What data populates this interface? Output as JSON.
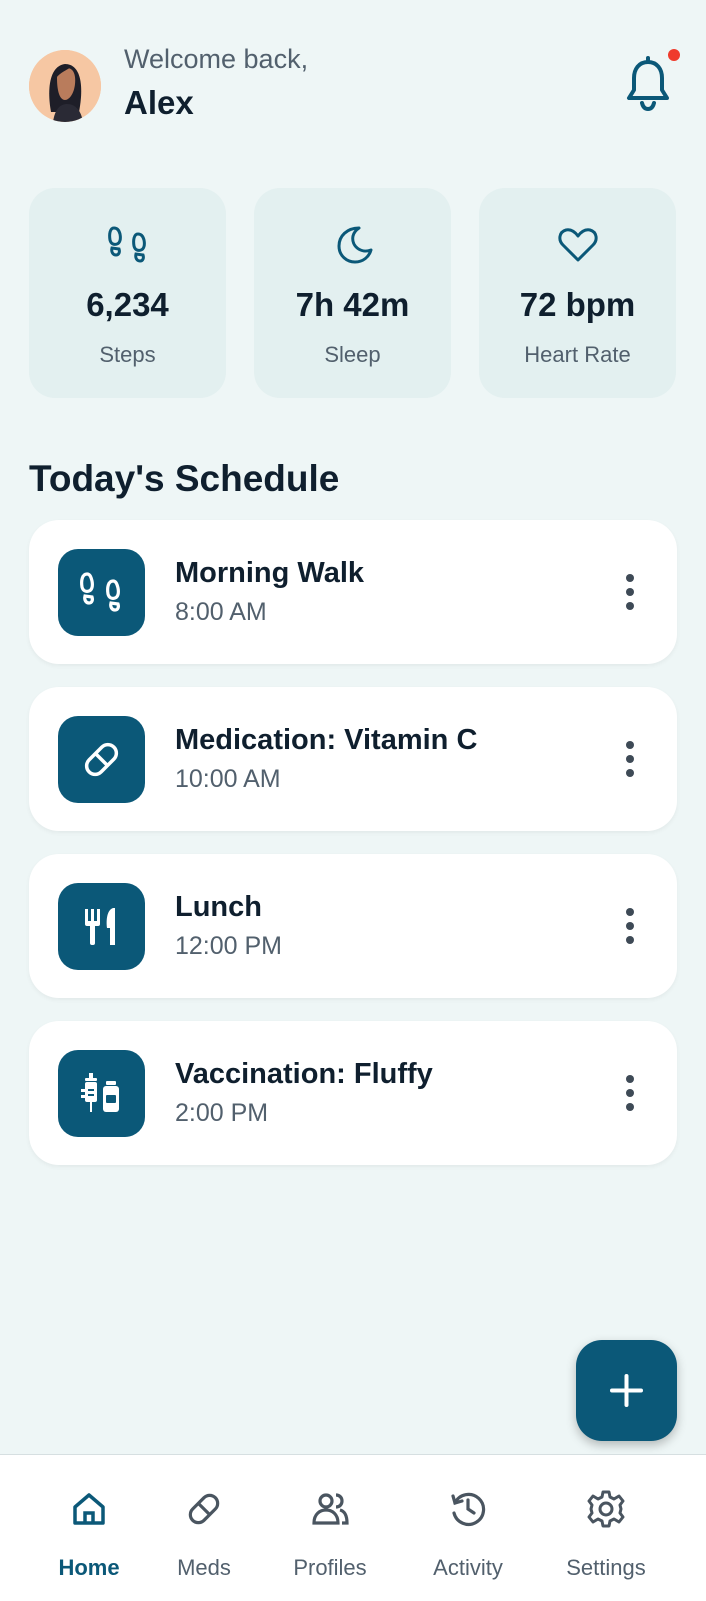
{
  "header": {
    "welcome_text": "Welcome back,",
    "user_name": "Alex",
    "notification_indicator": "red-dot"
  },
  "stats": [
    {
      "icon": "footprints-icon",
      "value": "6,234",
      "label": "Steps"
    },
    {
      "icon": "moon-icon",
      "value": "7h 42m",
      "label": "Sleep"
    },
    {
      "icon": "heart-icon",
      "value": "72 bpm",
      "label": "Heart Rate"
    }
  ],
  "schedule": {
    "title": "Today's Schedule",
    "items": [
      {
        "icon": "footprints-icon",
        "title": "Morning Walk",
        "time": "8:00 AM"
      },
      {
        "icon": "pill-icon",
        "title": "Medication: Vitamin C",
        "time": "10:00 AM"
      },
      {
        "icon": "utensils-icon",
        "title": "Lunch",
        "time": "12:00 PM"
      },
      {
        "icon": "syringe-vial-icon",
        "title": "Vaccination: Fluffy",
        "time": "2:00 PM"
      }
    ]
  },
  "fab": {
    "icon": "plus-icon"
  },
  "nav": {
    "items": [
      {
        "icon": "home-icon",
        "label": "Home",
        "active": true
      },
      {
        "icon": "pill-icon",
        "label": "Meds",
        "active": false
      },
      {
        "icon": "users-icon",
        "label": "Profiles",
        "active": false
      },
      {
        "icon": "history-icon",
        "label": "Activity",
        "active": false
      },
      {
        "icon": "gear-icon",
        "label": "Settings",
        "active": false
      }
    ]
  },
  "colors": {
    "background": "#eef6f6",
    "primary": "#0b5878",
    "card": "#ffffff",
    "stat_card": "#e3f0f0",
    "text_primary": "#0f1f2e",
    "text_secondary": "#52606d",
    "notification_dot": "#ef3b2c"
  }
}
